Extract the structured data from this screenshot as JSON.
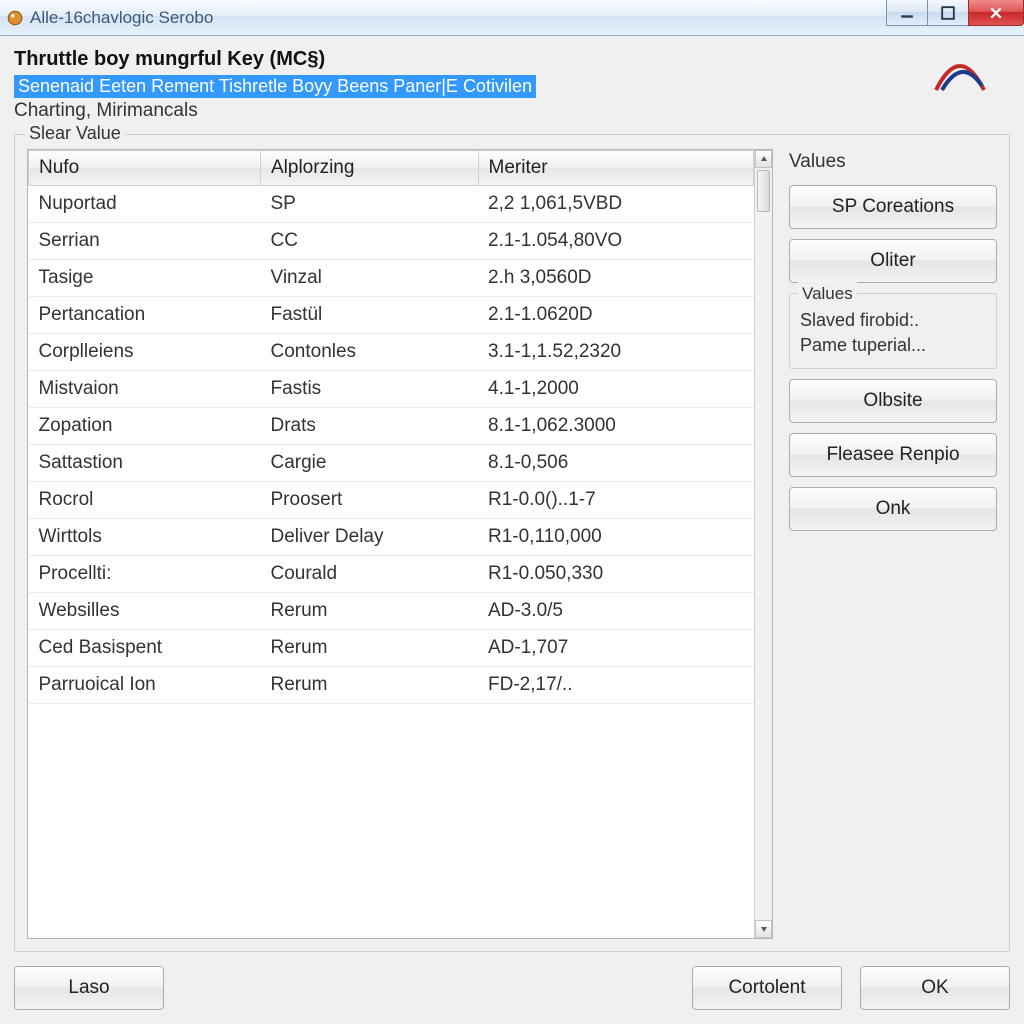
{
  "window": {
    "title": "Alle-16chavlogic Serobo"
  },
  "header": {
    "title": "Thruttle boy mungrful Key (MC§)",
    "path": "Senenaid Eeten Rement Tishretle Boyy Beens Paner|E Cotivilen",
    "subtitle": "Charting, Mirimancals"
  },
  "groupbox_label": "Slear Value",
  "columns": [
    "Nufo",
    "Alplorzing",
    "Meriter"
  ],
  "rows": [
    {
      "c0": "Nuportad",
      "c1": "SP",
      "c2": "2,2 1,061,5VBD"
    },
    {
      "c0": "Serrian",
      "c1": "CC",
      "c2": "2.1-1.054,80VO"
    },
    {
      "c0": "Tasige",
      "c1": "Vinzal",
      "c2": "2.h 3,0560D"
    },
    {
      "c0": "Pertancation",
      "c1": "Fastül",
      "c2": "2.1-1.0620D"
    },
    {
      "c0": "Corplleiens",
      "c1": "Contonles",
      "c2": "3.1-1,1.52,2320"
    },
    {
      "c0": "Mistvaion",
      "c1": "Fastis",
      "c2": "4.1-1,2000"
    },
    {
      "c0": "Zopation",
      "c1": "Drats",
      "c2": "8.1-1,062.3000"
    },
    {
      "c0": "Sattastion",
      "c1": "Cargie",
      "c2": "8.1-0,506"
    },
    {
      "c0": "Rocrol",
      "c1": "Proosert",
      "c2": "R1-0.0()..1-7"
    },
    {
      "c0": "Wirttols",
      "c1": "Deliver Delay",
      "c2": "R1-0,110,000"
    },
    {
      "c0": "Procellti:",
      "c1": "Courald",
      "c2": "R1-0.050,330"
    },
    {
      "c0": "Websilles",
      "c1": "Rerum",
      "c2": "AD-3.0/5"
    },
    {
      "c0": "Ced Basispent",
      "c1": "Rerum",
      "c2": "AD-1,707"
    },
    {
      "c0": "Parruoical Ion",
      "c1": "Rerum",
      "c2": "FD-2,17/.."
    }
  ],
  "side": {
    "values_label": "Values",
    "btn_sp": "SP Coreations",
    "btn_oliter": "Oliter",
    "group2_label": "Values",
    "group2_line1": "Slaved firobid:.",
    "group2_line2": "Pame tuperial...",
    "btn_olbsite": "Olbsite",
    "btn_fleasee": "Fleasee Renpio",
    "btn_onk": "Onk"
  },
  "footer": {
    "laso": "Laso",
    "cortolent": "Cortolent",
    "ok": "OK"
  }
}
